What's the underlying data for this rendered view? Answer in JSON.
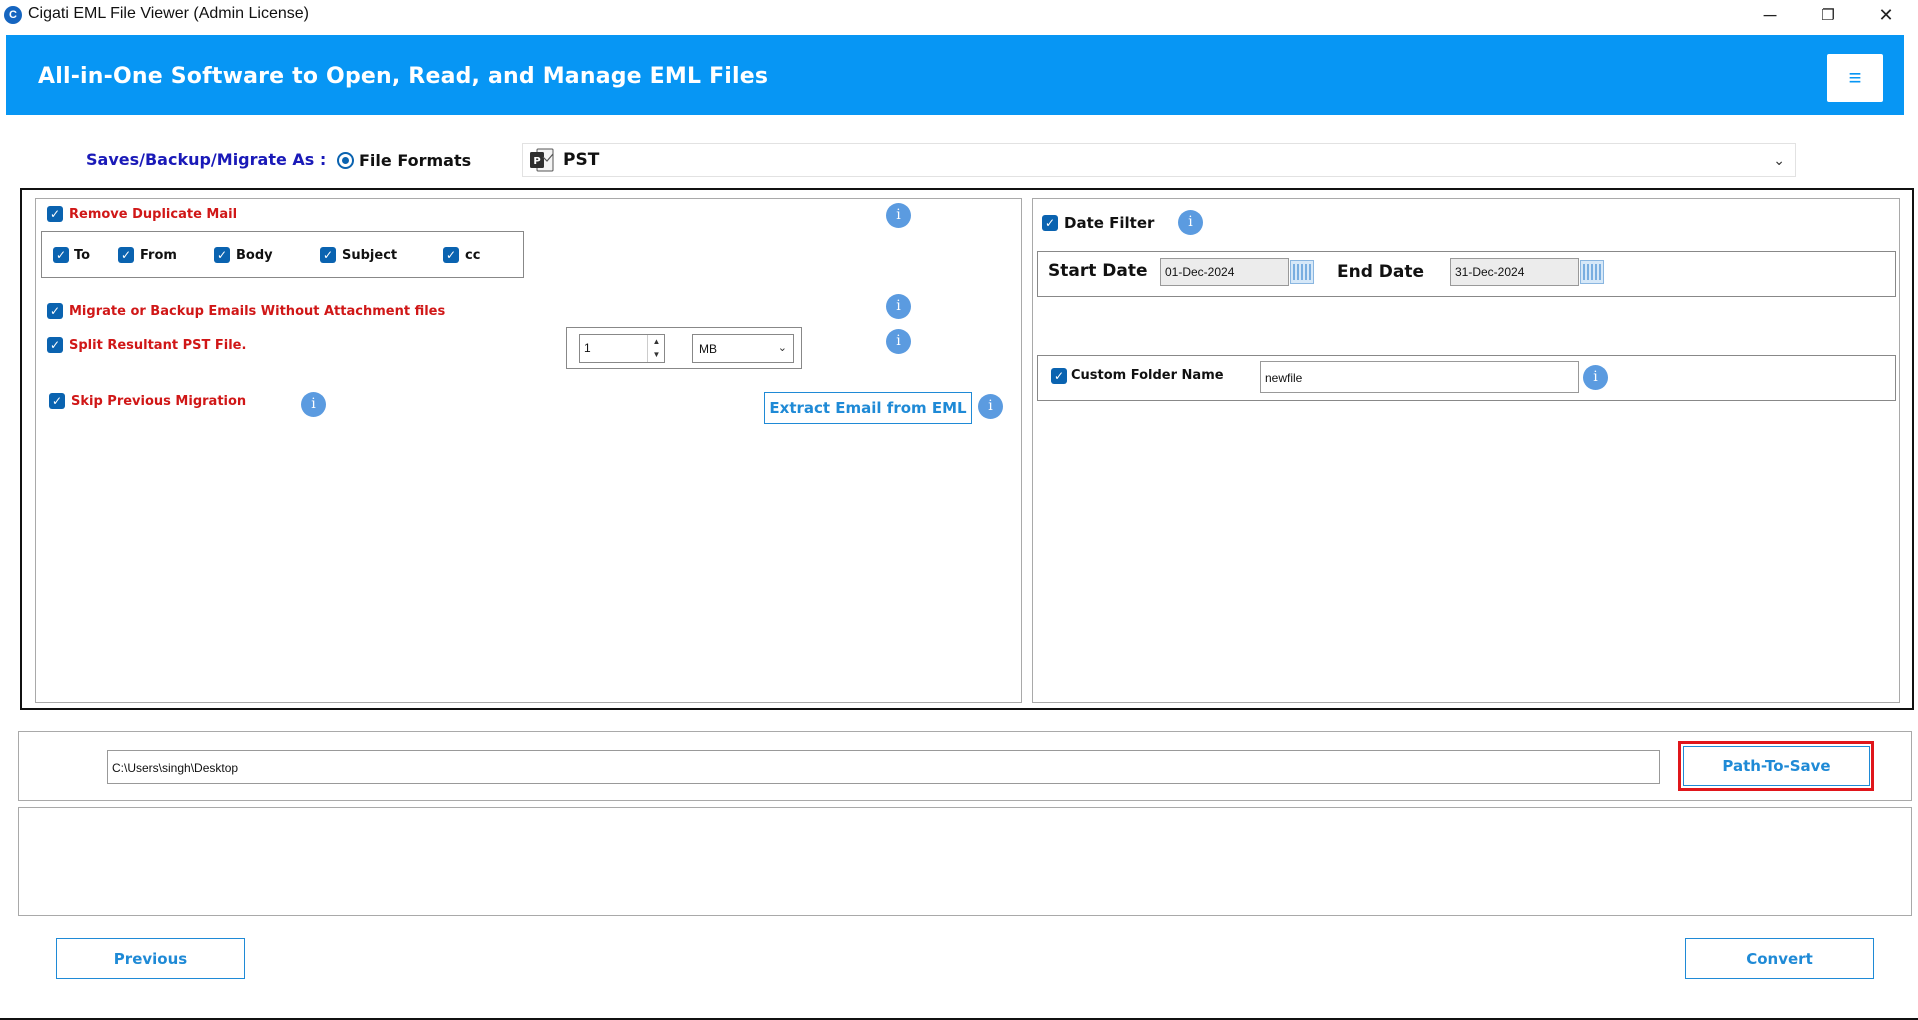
{
  "window": {
    "title": "Cigati EML File Viewer (Admin License)",
    "icon_letter": "C",
    "controls": {
      "minimize": "─",
      "restore": "❐",
      "close": "✕"
    }
  },
  "header": {
    "title": "All-in-One Software to Open, Read, and Manage EML Files",
    "menu_icon": "≡",
    "accent_color": "#0796f4"
  },
  "format_row": {
    "label": "Saves/Backup/Migrate As :",
    "radio_label": "File Formats",
    "radio_selected": true,
    "selected_format": "PST",
    "format_icon_letter": "P"
  },
  "options": {
    "remove_duplicate": {
      "label": "Remove Duplicate Mail",
      "checked": true
    },
    "duplicate_fields": [
      {
        "label": "To",
        "checked": true
      },
      {
        "label": "From",
        "checked": true
      },
      {
        "label": "Body",
        "checked": true
      },
      {
        "label": "Subject",
        "checked": true
      },
      {
        "label": "cc",
        "checked": true
      }
    ],
    "without_attachment": {
      "label": "Migrate or Backup Emails Without Attachment files",
      "checked": true
    },
    "split_pst": {
      "label": "Split Resultant PST File.",
      "checked": true,
      "size_value": "1",
      "unit": "MB"
    },
    "skip_previous": {
      "label": "Skip Previous Migration",
      "checked": true
    },
    "extract_button": "Extract Email from EML",
    "info_glyph": "i",
    "check_glyph": "✓"
  },
  "filters": {
    "date_filter": {
      "label": "Date Filter",
      "checked": true
    },
    "start_label": "Start Date",
    "start_value": "01-Dec-2024",
    "end_label": "End Date",
    "end_value": "31-Dec-2024",
    "custom_folder": {
      "label": "Custom Folder Name",
      "checked": true,
      "value": "newfile"
    }
  },
  "save_path": {
    "value": "C:\\Users\\singh\\Desktop",
    "button": "Path-To-Save",
    "highlight_color": "#e0161b"
  },
  "footer": {
    "previous": "Previous",
    "convert": "Convert"
  }
}
